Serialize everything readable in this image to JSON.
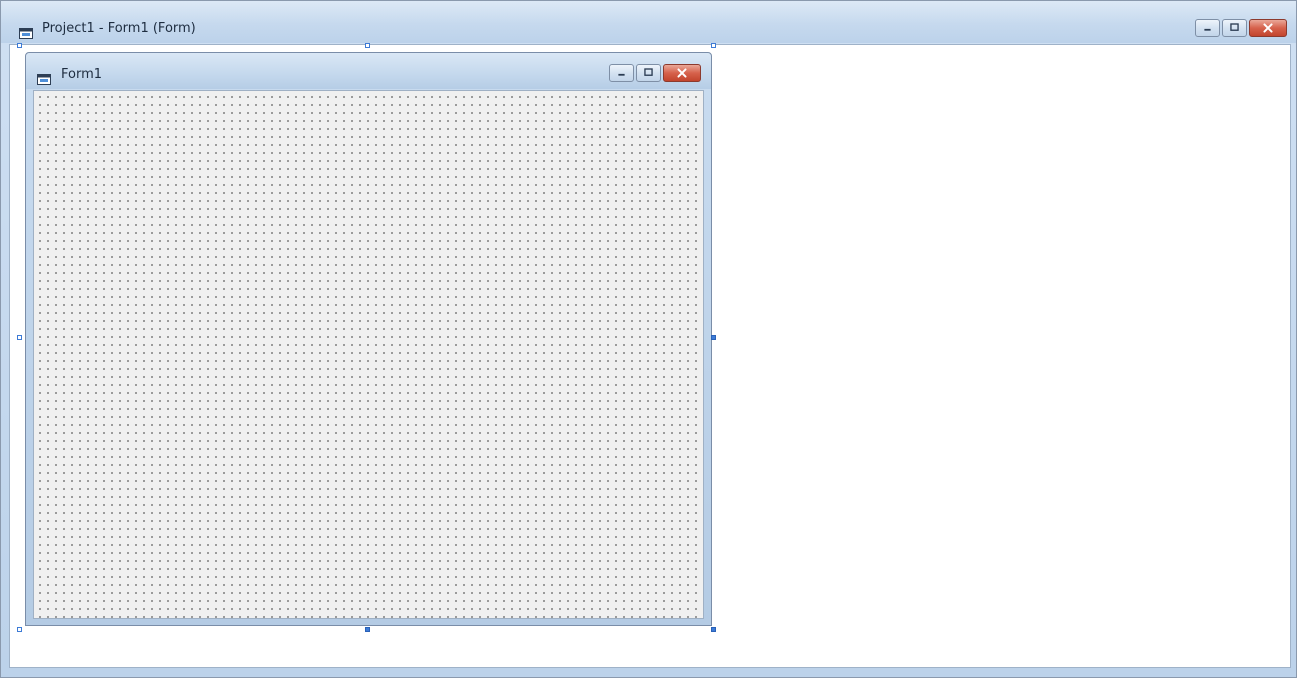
{
  "designer_window": {
    "title": "Project1 - Form1 (Form)",
    "icon": "form-icon",
    "caption_buttons": [
      "minimize-icon",
      "maximize-icon",
      "close-icon"
    ]
  },
  "form": {
    "title": "Form1",
    "icon": "form-icon",
    "caption_buttons": [
      "minimize-icon",
      "maximize-icon",
      "close-icon"
    ],
    "grid": true
  },
  "colors": {
    "titlebar": "#c6d9ee",
    "close_button": "#c2442d",
    "selection_handle": "#3d7bd6",
    "form_background": "#f0f0f0"
  }
}
